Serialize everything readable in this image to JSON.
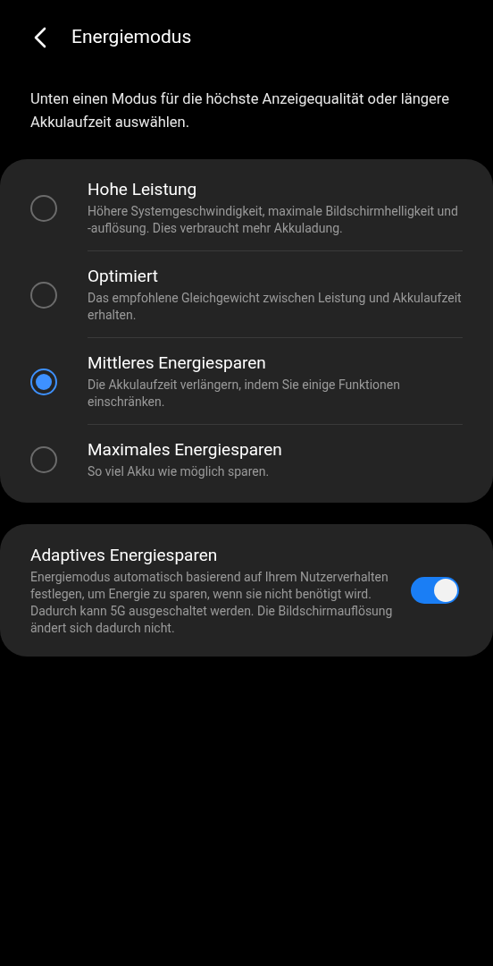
{
  "header": {
    "title": "Energiemodus"
  },
  "intro": "Unten einen Modus für die höchste Anzeigequalität oder längere Akkulaufzeit auswählen.",
  "modes": [
    {
      "title": "Hohe Leistung",
      "description": "Höhere Systemgeschwindigkeit, maximale Bildschirmhelligkeit und -auflösung. Dies verbraucht mehr Akkuladung.",
      "selected": false
    },
    {
      "title": "Optimiert",
      "description": "Das empfohlene Gleichgewicht zwischen Leistung und Akkulaufzeit erhalten.",
      "selected": false
    },
    {
      "title": "Mittleres Energiesparen",
      "description": "Die Akkulaufzeit verlängern, indem Sie einige Funktionen einschränken.",
      "selected": true
    },
    {
      "title": "Maximales Energiesparen",
      "description": "So viel Akku wie möglich sparen.",
      "selected": false
    }
  ],
  "adaptive": {
    "title": "Adaptives Energiesparen",
    "description": "Energiemodus automatisch basierend auf Ihrem Nutzerverhalten festlegen, um Energie zu sparen, wenn sie nicht benötigt wird. Dadurch kann 5G ausgeschaltet werden. Die Bildschirmauflösung ändert sich dadurch nicht.",
    "on": true
  }
}
